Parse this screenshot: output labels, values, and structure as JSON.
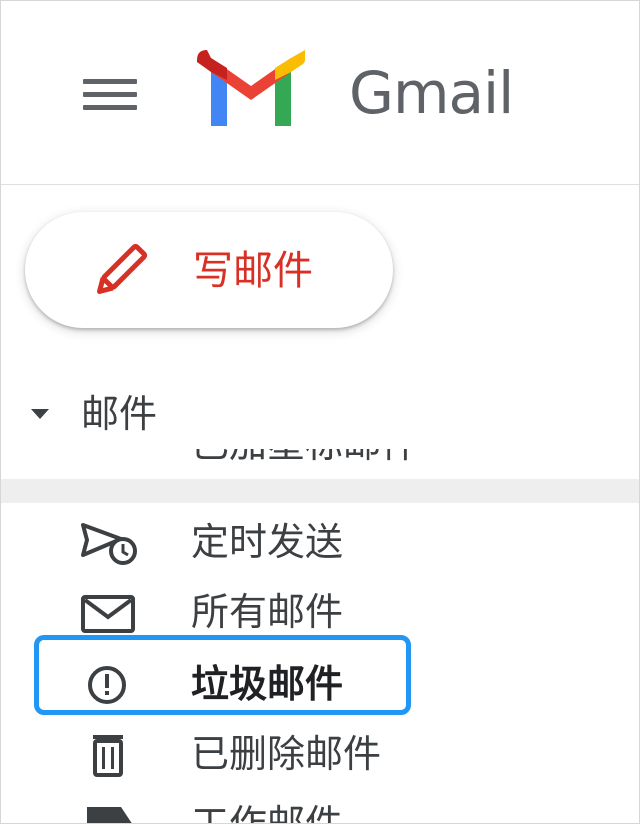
{
  "header": {
    "app_name": "Gmail",
    "menu_icon": "hamburger-menu-icon",
    "logo_icon": "gmail-logo-icon"
  },
  "compose": {
    "label": "写邮件",
    "icon": "pencil-icon",
    "color": "#d93025"
  },
  "section": {
    "label": "邮件",
    "icon": "caret-down-icon"
  },
  "nav": {
    "items": [
      {
        "label": "已加星标邮件",
        "icon": "clipped-label-icon"
      },
      {
        "label": "定时发送",
        "icon": "scheduled-send-icon"
      },
      {
        "label": "所有邮件",
        "icon": "envelope-icon"
      },
      {
        "label": "垃圾邮件",
        "icon": "spam-icon",
        "selected": true
      },
      {
        "label": "已删除邮件",
        "icon": "trash-icon"
      },
      {
        "label": "工作邮件",
        "icon": "label-icon"
      }
    ]
  },
  "colors": {
    "highlight": "#2196f3",
    "text": "#3c4043"
  }
}
